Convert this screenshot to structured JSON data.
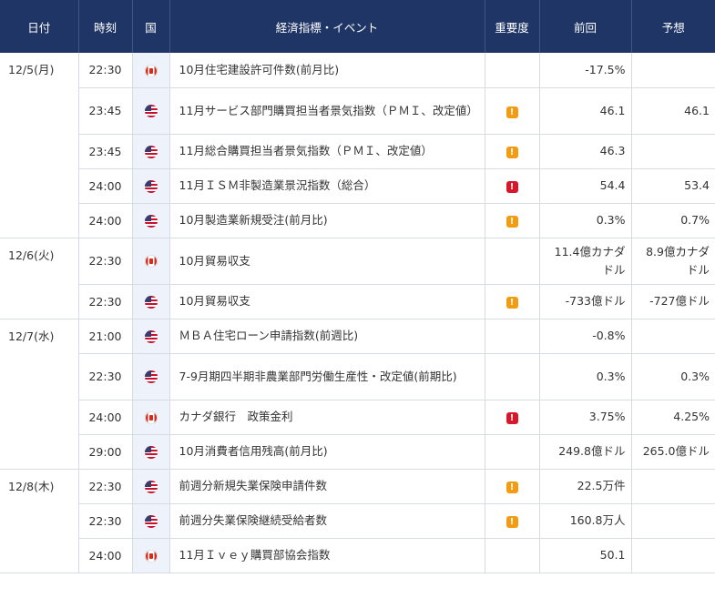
{
  "header": {
    "date": "日付",
    "time": "時刻",
    "country": "国",
    "event": "経済指標・イベント",
    "importance": "重要度",
    "previous": "前回",
    "forecast": "予想"
  },
  "colors": {
    "header_bg": "#1f3566",
    "country_col_bg": "#eef2fa",
    "importance_mid": "#f39c12",
    "importance_high": "#d9172a"
  },
  "days": [
    {
      "date": "12/5(月)",
      "rows": [
        {
          "time": "22:30",
          "country": "canada-flag-icon",
          "event": "10月住宅建設許可件数(前月比)",
          "importance": "",
          "importance_symbol": "",
          "previous": "-17.5%",
          "forecast": ""
        },
        {
          "time": "23:45",
          "country": "us-flag-icon",
          "event": "11月サービス部門購買担当者景気指数（ＰＭＩ、改定値）",
          "importance": "mid",
          "importance_symbol": "!",
          "previous": "46.1",
          "forecast": "46.1"
        },
        {
          "time": "23:45",
          "country": "us-flag-icon",
          "event": "11月総合購買担当者景気指数（ＰＭＩ、改定値）",
          "importance": "mid",
          "importance_symbol": "!",
          "previous": "46.3",
          "forecast": ""
        },
        {
          "time": "24:00",
          "country": "us-flag-icon",
          "event": "11月ＩＳＭ非製造業景況指数（総合）",
          "importance": "high",
          "importance_symbol": "!",
          "previous": "54.4",
          "forecast": "53.4"
        },
        {
          "time": "24:00",
          "country": "us-flag-icon",
          "event": "10月製造業新規受注(前月比)",
          "importance": "mid",
          "importance_symbol": "!",
          "previous": "0.3%",
          "forecast": "0.7%"
        }
      ]
    },
    {
      "date": "12/6(火)",
      "rows": [
        {
          "time": "22:30",
          "country": "canada-flag-icon",
          "event": "10月貿易収支",
          "importance": "",
          "importance_symbol": "",
          "previous": "11.4億カナダドル",
          "forecast": "8.9億カナダドル"
        },
        {
          "time": "22:30",
          "country": "us-flag-icon",
          "event": "10月貿易収支",
          "importance": "mid",
          "importance_symbol": "!",
          "previous": "-733億ドル",
          "forecast": "-727億ドル"
        }
      ]
    },
    {
      "date": "12/7(水)",
      "rows": [
        {
          "time": "21:00",
          "country": "us-flag-icon",
          "event": "ＭＢＡ住宅ローン申請指数(前週比)",
          "importance": "",
          "importance_symbol": "",
          "previous": "-0.8%",
          "forecast": ""
        },
        {
          "time": "22:30",
          "country": "us-flag-icon",
          "event": "7-9月期四半期非農業部門労働生産性・改定値(前期比)",
          "importance": "",
          "importance_symbol": "",
          "previous": "0.3%",
          "forecast": "0.3%"
        },
        {
          "time": "24:00",
          "country": "canada-flag-icon",
          "event": "カナダ銀行　政策金利",
          "importance": "high",
          "importance_symbol": "!",
          "previous": "3.75%",
          "forecast": "4.25%"
        },
        {
          "time": "29:00",
          "country": "us-flag-icon",
          "event": "10月消費者信用残高(前月比)",
          "importance": "",
          "importance_symbol": "",
          "previous": "249.8億ドル",
          "forecast": "265.0億ドル"
        }
      ]
    },
    {
      "date": "12/8(木)",
      "rows": [
        {
          "time": "22:30",
          "country": "us-flag-icon",
          "event": "前週分新規失業保険申請件数",
          "importance": "mid",
          "importance_symbol": "!",
          "previous": "22.5万件",
          "forecast": ""
        },
        {
          "time": "22:30",
          "country": "us-flag-icon",
          "event": "前週分失業保険継続受給者数",
          "importance": "mid",
          "importance_symbol": "!",
          "previous": "160.8万人",
          "forecast": ""
        },
        {
          "time": "24:00",
          "country": "canada-flag-icon",
          "event": "11月Ｉｖｅｙ購買部協会指数",
          "importance": "",
          "importance_symbol": "",
          "previous": "50.1",
          "forecast": ""
        }
      ]
    }
  ]
}
